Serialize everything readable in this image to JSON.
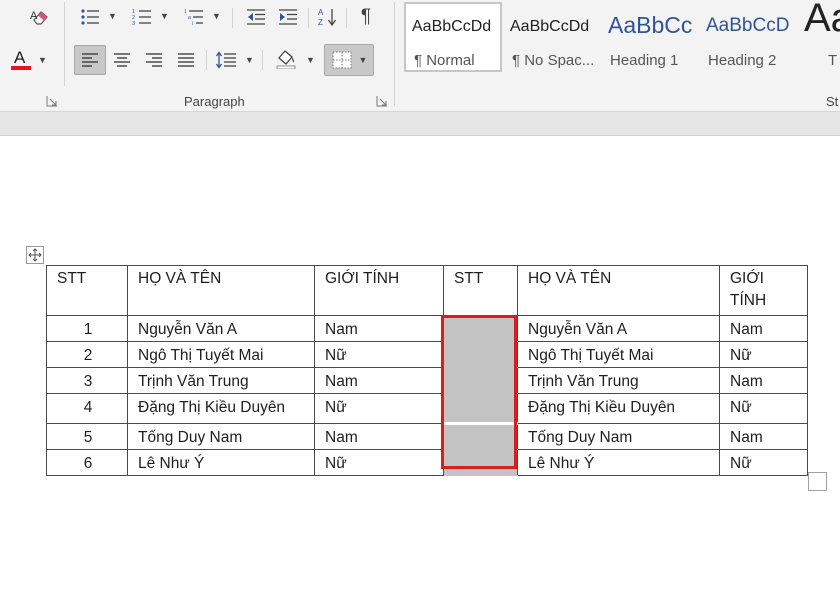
{
  "app": {
    "accent": "#2b579a",
    "highlight_color": "#d81e1e",
    "font_color_swatch": "#e81123"
  },
  "ribbon": {
    "paragraph_group_label": "Paragraph",
    "styles_group_label_partial": "St",
    "paragraph_mark_glyph": "¶",
    "font_color_letter": "A",
    "icons": [
      "eraser-icon",
      "font-color-icon",
      "bullets-icon",
      "numbering-icon",
      "multilevel-list-icon",
      "decrease-indent-icon",
      "increase-indent-icon",
      "sort-icon",
      "show-formatting-icon",
      "align-left-icon",
      "center-icon",
      "align-right-icon",
      "justify-icon",
      "line-spacing-icon",
      "shading-icon",
      "borders-icon",
      "dialog-launcher-icon"
    ]
  },
  "styles": [
    {
      "preview": "AaBbCcDd",
      "name": "¶ Normal",
      "active": true
    },
    {
      "preview": "AaBbCcDd",
      "name": "¶ No Spac...",
      "active": false
    },
    {
      "preview": "AaBbCc",
      "name": "Heading 1",
      "active": false
    },
    {
      "preview": "AaBbCcD",
      "name": "Heading 2",
      "active": false
    },
    {
      "preview": "Aa",
      "name": "T",
      "active": false
    }
  ],
  "table": {
    "headers": [
      "STT",
      "HỌ VÀ TÊN",
      "GIỚI TÍNH",
      "STT",
      "HỌ VÀ TÊN",
      "GIỚI"
    ],
    "header_last_line2": "TÍNH",
    "rows": [
      {
        "stt": "1",
        "name": "Nguyễn Văn A",
        "gender": "Nam",
        "name2": "Nguyễn Văn A",
        "gender2": "Nam"
      },
      {
        "stt": "2",
        "name": "Ngô Thị Tuyết Mai",
        "gender": "Nữ",
        "name2": "Ngô Thị Tuyết Mai",
        "gender2": "Nữ"
      },
      {
        "stt": "3",
        "name": "Trịnh Văn Trung",
        "gender": "Nam",
        "name2": "Trịnh Văn Trung",
        "gender2": "Nam"
      },
      {
        "stt": "4",
        "name": "Đặng Thị Kiều Duyên",
        "gender": "Nữ",
        "name2": "Đặng Thị Kiều Duyên",
        "gender2": "Nữ"
      },
      {
        "stt": "5",
        "name": "Tống Duy Nam",
        "gender": "Nam",
        "name2": "Tống Duy Nam",
        "gender2": "Nam"
      },
      {
        "stt": "6",
        "name": "Lê Như Ý",
        "gender": "Nữ",
        "name2": "Lê Như Ý",
        "gender2": "Nữ"
      }
    ]
  }
}
